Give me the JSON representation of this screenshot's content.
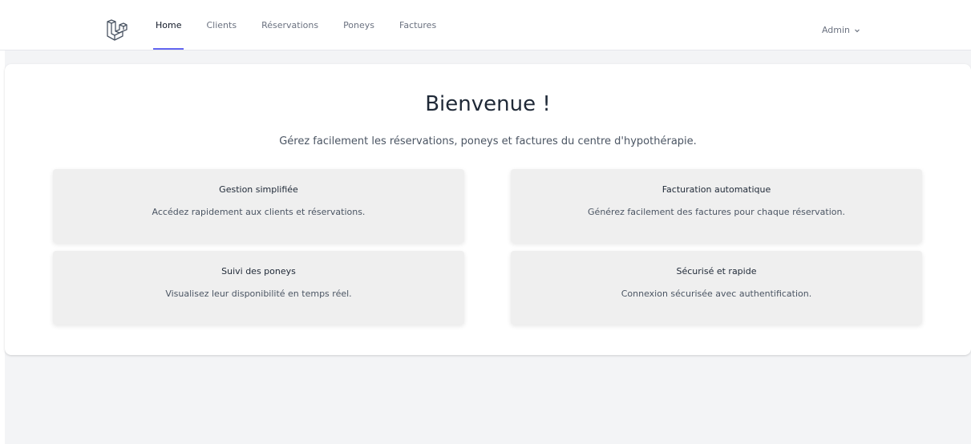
{
  "nav": {
    "logo_icon": "laravel-logo-icon",
    "links": [
      {
        "label": "Home",
        "active": true
      },
      {
        "label": "Clients",
        "active": false
      },
      {
        "label": "Réservations",
        "active": false
      },
      {
        "label": "Poneys",
        "active": false
      },
      {
        "label": "Factures",
        "active": false
      }
    ],
    "user_label": "Admin",
    "user_menu_icon": "chevron-down-icon",
    "active_indicator_color": "#6366f1"
  },
  "main": {
    "title": "Bienvenue !",
    "subtitle": "Gérez facilement les réservations, poneys et factures du centre d'hypothérapie.",
    "features": [
      {
        "title": "Gestion simplifiée",
        "description": "Accédez rapidement aux clients et réservations."
      },
      {
        "title": "Facturation automatique",
        "description": "Générez facilement des factures pour chaque réservation."
      },
      {
        "title": "Suivi des poneys",
        "description": "Visualisez leur disponibilité en temps réel."
      },
      {
        "title": "Sécurisé et rapide",
        "description": "Connexion sécurisée avec authentification."
      }
    ]
  }
}
